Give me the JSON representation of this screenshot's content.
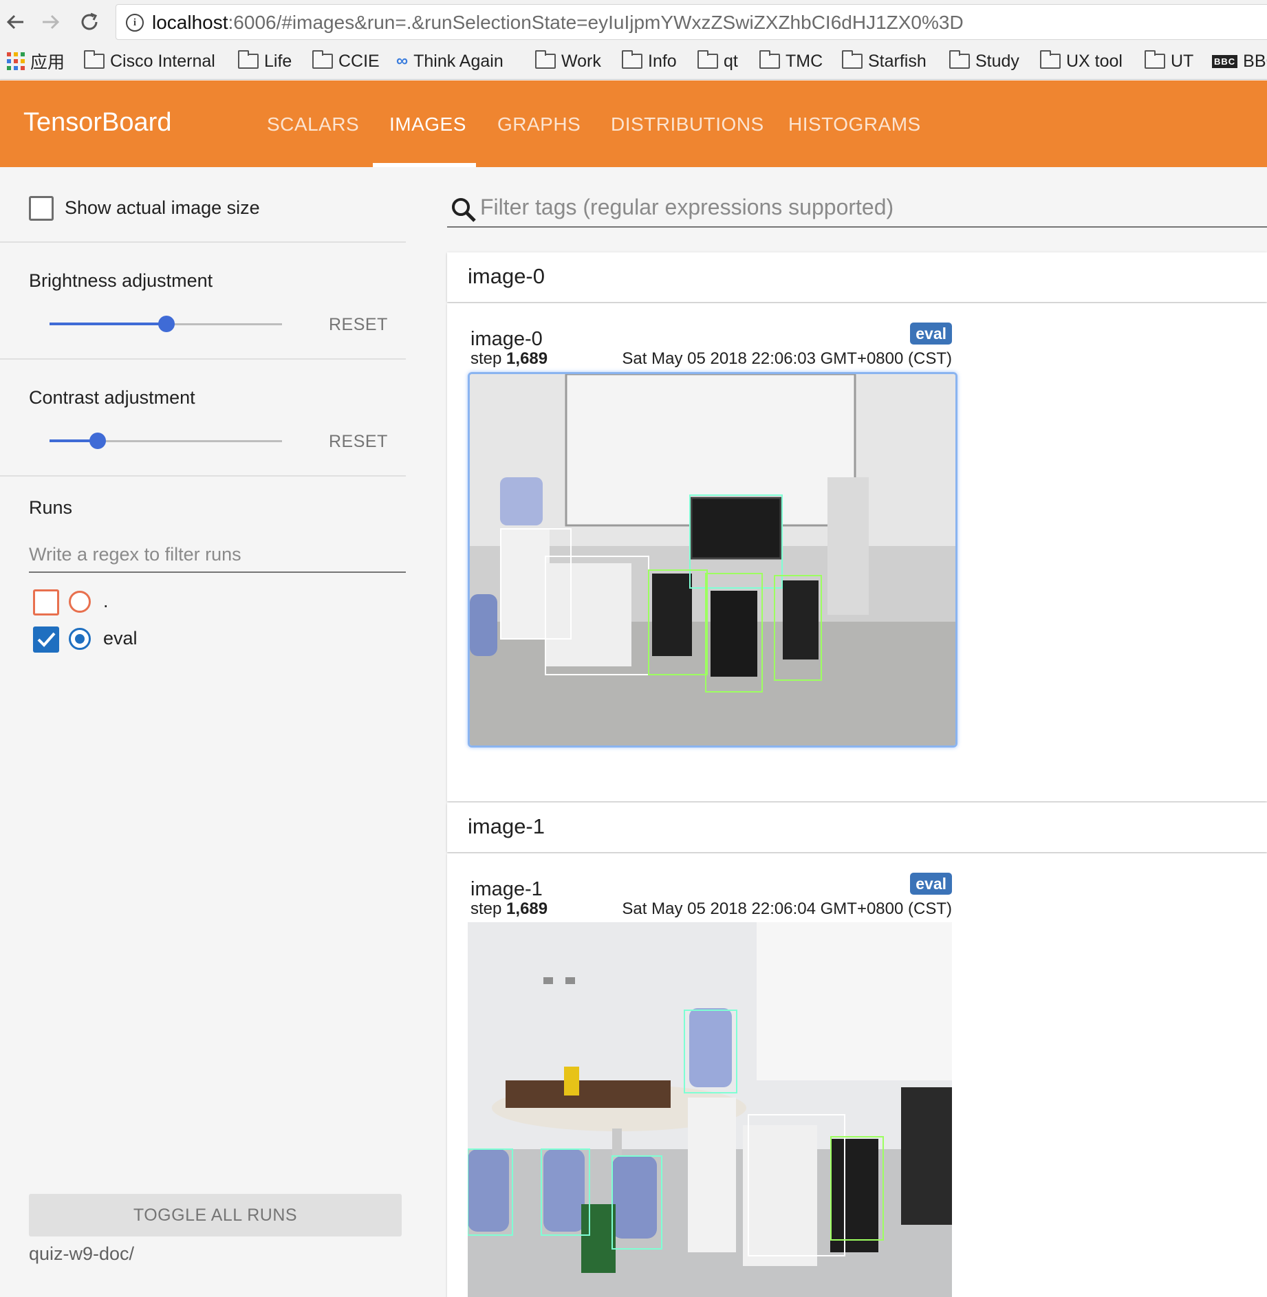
{
  "browser": {
    "url_host": "localhost",
    "url_rest": ":6006/#images&run=.&runSelectionState=eyIuIjpmYWxzZSwiZXZhbCI6dHJ1ZX0%3D",
    "bookmarks": [
      {
        "label": "应用",
        "icon": "apps-grid-icon"
      },
      {
        "label": "Cisco Internal",
        "icon": "folder-icon"
      },
      {
        "label": "Life",
        "icon": "folder-icon"
      },
      {
        "label": "CCIE",
        "icon": "folder-icon"
      },
      {
        "label": "Think Again",
        "icon": "infinity-icon"
      },
      {
        "label": "Work",
        "icon": "folder-icon"
      },
      {
        "label": "Info",
        "icon": "folder-icon"
      },
      {
        "label": "qt",
        "icon": "folder-icon"
      },
      {
        "label": "TMC",
        "icon": "folder-icon"
      },
      {
        "label": "Starfish",
        "icon": "folder-icon"
      },
      {
        "label": "Study",
        "icon": "folder-icon"
      },
      {
        "label": "UX tool",
        "icon": "folder-icon"
      },
      {
        "label": "UT",
        "icon": "folder-icon"
      },
      {
        "label": "BBC",
        "icon": "bbc-icon",
        "icon_text": "BBC"
      }
    ]
  },
  "header": {
    "logo": "TensorBoard",
    "tabs": [
      {
        "label": "SCALARS",
        "active": false
      },
      {
        "label": "IMAGES",
        "active": true
      },
      {
        "label": "GRAPHS",
        "active": false
      },
      {
        "label": "DISTRIBUTIONS",
        "active": false
      },
      {
        "label": "HISTOGRAMS",
        "active": false
      }
    ],
    "color": "#ef8530"
  },
  "sidebar": {
    "show_actual_size": {
      "label": "Show actual image size",
      "checked": false
    },
    "brightness": {
      "label": "Brightness adjustment",
      "value_fraction": 0.5,
      "reset_label": "RESET"
    },
    "contrast": {
      "label": "Contrast adjustment",
      "value_fraction": 0.2,
      "reset_label": "RESET"
    },
    "runs": {
      "title": "Runs",
      "filter_placeholder": "Write a regex to filter runs",
      "items": [
        {
          "name": ".",
          "checked": false,
          "selected": false,
          "color": "#e8704e"
        },
        {
          "name": "eval",
          "checked": true,
          "selected": true,
          "color": "#1f6fc0"
        }
      ]
    },
    "toggle_all_label": "TOGGLE ALL RUNS",
    "logdir": "quiz-w9-doc/"
  },
  "main": {
    "filter_placeholder": "Filter tags (regular expressions supported)",
    "groups": [
      {
        "header": "image-0",
        "card": {
          "title": "image-0",
          "run_badge": "eval",
          "step_label": "step",
          "step": "1,689",
          "timestamp": "Sat May 05 2018 22:06:03 GMT+0800 (CST)"
        }
      },
      {
        "header": "image-1",
        "card": {
          "title": "image-1",
          "run_badge": "eval",
          "step_label": "step",
          "step": "1,689",
          "timestamp": "Sat May 05 2018 22:06:04 GMT+0800 (CST)"
        }
      }
    ]
  }
}
